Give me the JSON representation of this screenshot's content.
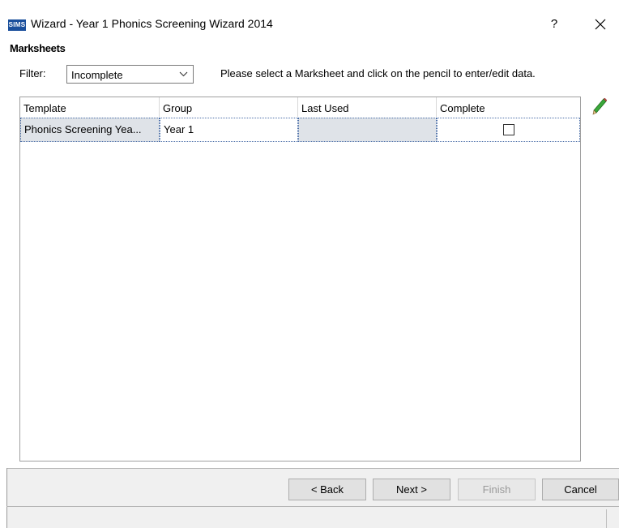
{
  "window": {
    "app_icon_text": "SIMS",
    "title": "Wizard - Year 1 Phonics Screening Wizard 2014",
    "help_label": "?"
  },
  "section": {
    "header": "Marksheets"
  },
  "filter": {
    "label": "Filter:",
    "selected": "Incomplete",
    "instruction": "Please select a Marksheet and click on the pencil to enter/edit data."
  },
  "grid": {
    "columns": [
      "Template",
      "Group",
      "Last Used",
      "Complete"
    ],
    "rows": [
      {
        "template": "Phonics Screening Yea...",
        "group": "Year  1",
        "last_used": "",
        "complete": false
      }
    ]
  },
  "buttons": {
    "back": "< Back",
    "next": "Next >",
    "finish": "Finish",
    "cancel": "Cancel"
  },
  "colors": {
    "app_icon_bg": "#1a4f9c",
    "selected_row": "#dfe3e8",
    "pencil": "#3aa83a"
  },
  "icons": {
    "close": "close-icon",
    "dropdown": "chevron-down-icon",
    "edit": "pencil-icon"
  }
}
